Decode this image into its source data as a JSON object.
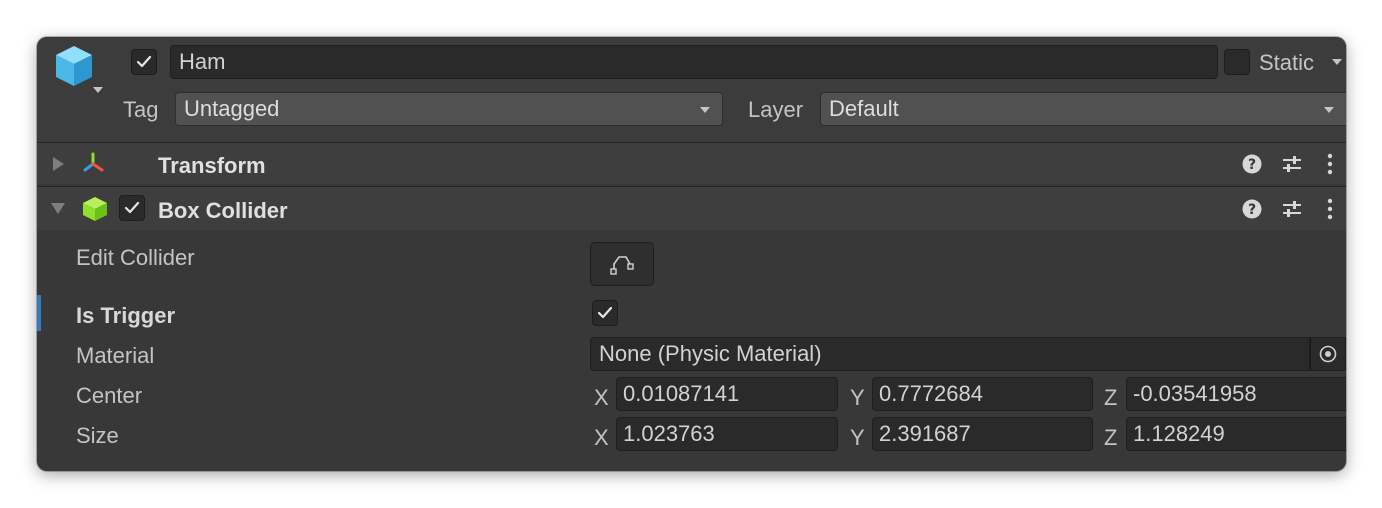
{
  "gameobject": {
    "active_checked": true,
    "name": "Ham",
    "static_label": "Static",
    "static_checked": false,
    "tag_label": "Tag",
    "tag_value": "Untagged",
    "layer_label": "Layer",
    "layer_value": "Default"
  },
  "components": {
    "transform": {
      "title": "Transform",
      "expanded": false
    },
    "box_collider": {
      "title": "Box Collider",
      "enabled": true,
      "expanded": true,
      "properties": {
        "edit_collider_label": "Edit Collider",
        "is_trigger_label": "Is Trigger",
        "is_trigger_checked": true,
        "material_label": "Material",
        "material_value": "None (Physic Material)",
        "center_label": "Center",
        "center": {
          "x_label": "X",
          "x": "0.01087141",
          "y_label": "Y",
          "y": "0.7772684",
          "z_label": "Z",
          "z": "-0.03541958"
        },
        "size_label": "Size",
        "size": {
          "x_label": "X",
          "x": "1.023763",
          "y_label": "Y",
          "y": "2.391687",
          "z_label": "Z",
          "z": "1.128249"
        }
      }
    }
  },
  "icons": [
    "gameobject-cube-icon",
    "transform-icon",
    "box-collider-icon",
    "help-icon",
    "preset-icon",
    "more-menu-icon",
    "edit-collider-icon",
    "object-picker-icon"
  ],
  "colors": {
    "window_bg": "#383838",
    "field_bg": "#2a2a2a",
    "accent_bar": "#3a79bb",
    "cube_blue": "#5fc8f4",
    "collider_green": "#8ee02c"
  }
}
